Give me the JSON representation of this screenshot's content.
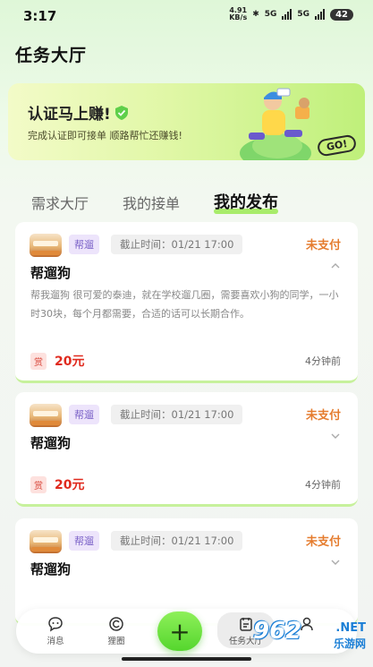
{
  "status_bar": {
    "time": "3:17",
    "speed_value": "4.91",
    "speed_unit": "KB/s",
    "net1": "5G",
    "net2": "5G",
    "battery": "42"
  },
  "app": {
    "title": "任务大厅"
  },
  "banner": {
    "title": "认证马上赚!",
    "subtitle": "完成认证即可接单 顺路帮忙还赚钱!",
    "go_label": "GO!"
  },
  "tabs": [
    {
      "label": "需求大厅",
      "active": false
    },
    {
      "label": "我的接单",
      "active": false
    },
    {
      "label": "我的发布",
      "active": true
    }
  ],
  "orders": [
    {
      "tag": "帮遛",
      "deadline": "截止时间：01/21 17:00",
      "status": "未支付",
      "title": "帮遛狗",
      "description": "帮我遛狗 很可爱的泰迪，就在学校遛几圈，需要喜欢小狗的同学，一小时30块，每个月都需要，合适的话可以长期合作。",
      "reward_badge": "赏",
      "reward": "20元",
      "time_ago": "4分钟前"
    },
    {
      "tag": "帮遛",
      "deadline": "截止时间：01/21 17:00",
      "status": "未支付",
      "title": "帮遛狗",
      "reward_badge": "赏",
      "reward": "20元",
      "time_ago": "4分钟前"
    },
    {
      "tag": "帮遛",
      "deadline": "截止时间：01/21 17:00",
      "status": "未支付",
      "title": "帮遛狗"
    }
  ],
  "bottom_nav": {
    "messages": "消息",
    "circle": "狸圈",
    "add": "+",
    "tasks": "任务大厅"
  },
  "watermark": {
    "logo": "962",
    "net": ".NET",
    "site": "乐游网"
  },
  "colors": {
    "accent": "#8ef05a",
    "status": "#e57c2e",
    "reward": "#e02a1e",
    "tag": "#7b62c8"
  }
}
